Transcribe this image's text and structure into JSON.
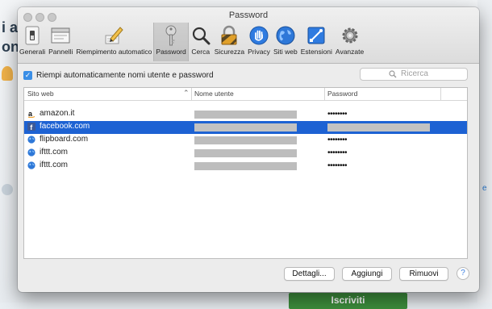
{
  "background": {
    "fragments": [
      "i a",
      "on"
    ],
    "link_fragment": "e",
    "cta_label": "Iscriviti"
  },
  "window": {
    "title": "Password"
  },
  "toolbar": {
    "items": [
      {
        "label": "Generali",
        "icon": "switch-icon"
      },
      {
        "label": "Pannelli",
        "icon": "tabs-icon"
      },
      {
        "label": "Riempimento automatico",
        "icon": "pencil-icon"
      },
      {
        "label": "Password",
        "icon": "key-icon",
        "selected": true
      },
      {
        "label": "Cerca",
        "icon": "magnifier-icon"
      },
      {
        "label": "Sicurezza",
        "icon": "padlock-icon"
      },
      {
        "label": "Privacy",
        "icon": "hand-icon"
      },
      {
        "label": "Siti web",
        "icon": "globe-icon"
      },
      {
        "label": "Estensioni",
        "icon": "puzzle-icon"
      },
      {
        "label": "Avanzate",
        "icon": "gear-icon"
      }
    ]
  },
  "autofill": {
    "checked": true,
    "label": "Riempi automaticamente nomi utente e password"
  },
  "search": {
    "placeholder": "Ricerca"
  },
  "table": {
    "columns": [
      "Sito web",
      "Nome utente",
      "Password"
    ],
    "rows": [
      {
        "site": "amazon.it",
        "icon": "amazon-icon",
        "password": "••••••••",
        "selected": false
      },
      {
        "site": "facebook.com",
        "icon": "facebook-icon",
        "password": "",
        "selected": true
      },
      {
        "site": "flipboard.com",
        "icon": "globe-icon",
        "password": "••••••••",
        "selected": false
      },
      {
        "site": "ifttt.com",
        "icon": "globe-icon",
        "password": "••••••••",
        "selected": false
      },
      {
        "site": "ifttt.com",
        "icon": "globe-icon",
        "password": "••••••••",
        "selected": false
      }
    ]
  },
  "buttons": {
    "details": "Dettagli...",
    "add": "Aggiungi",
    "remove": "Rimuovi",
    "help": "?"
  },
  "colors": {
    "selection": "#1d62d3",
    "checkbox": "#3a8ee6"
  }
}
